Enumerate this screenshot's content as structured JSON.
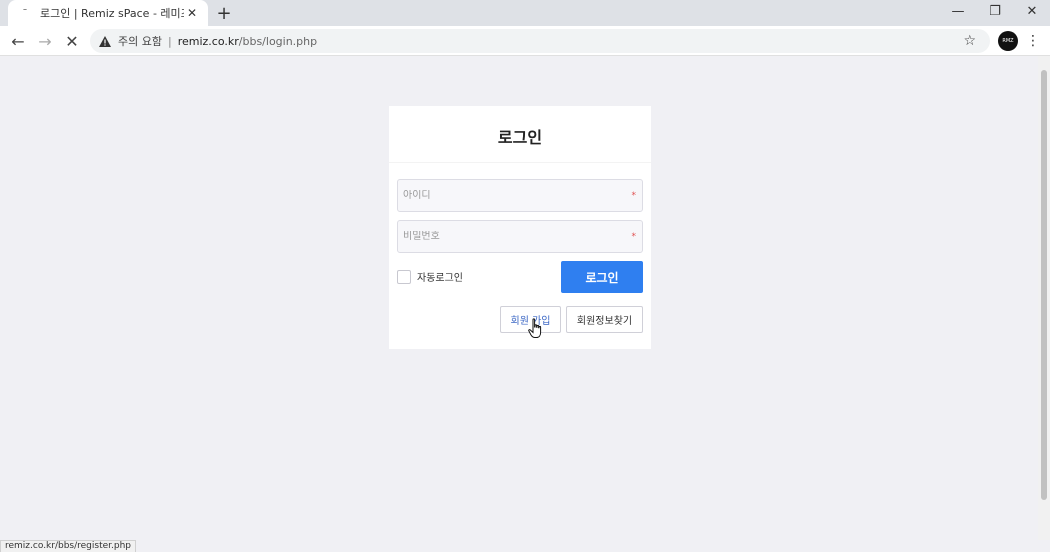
{
  "browser": {
    "tab": {
      "favicon_glyph": "ˉ",
      "title": "로그인 | Remiz sPace - 레미즈",
      "close_glyph": "✕"
    },
    "new_tab_glyph": "+",
    "window_controls": {
      "minimize": "—",
      "restore": "❐",
      "close": "✕"
    },
    "toolbar": {
      "back_glyph": "←",
      "forward_glyph": "→",
      "stop_glyph": "✕",
      "security_label": "주의 요함",
      "separator": "|",
      "url_host": "remiz.co.kr",
      "url_path": "/bbs/login.php",
      "bookmark_glyph": "☆",
      "profile_text": "RMZ",
      "menu_glyph": "⋮"
    }
  },
  "login": {
    "title": "로그인",
    "id_placeholder": "아이디",
    "password_placeholder": "비밀번호",
    "required_mark": "*",
    "remember_label": "자동로그인",
    "login_button": "로그인",
    "register_button": "회원 가입",
    "find_info_button": "회원정보찾기"
  },
  "status_bar": {
    "text": "remiz.co.kr/bbs/register.php"
  },
  "colors": {
    "primary_button": "#2f7ff0",
    "page_background": "#f0f0f4",
    "required": "#e05050"
  }
}
